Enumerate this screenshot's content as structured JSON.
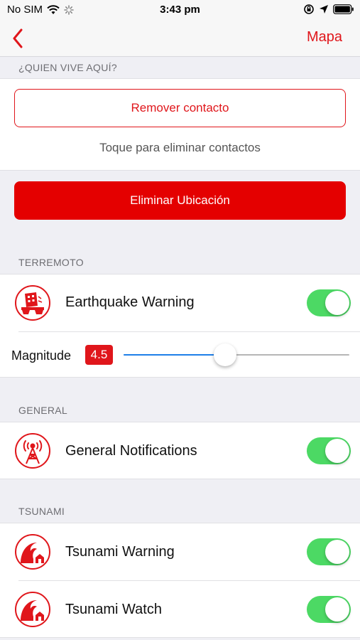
{
  "status_bar": {
    "carrier": "No SIM",
    "time": "3:43 pm",
    "icons": [
      "wifi-icon",
      "activity-spinner-icon",
      "orientation-lock-icon",
      "location-arrow-icon",
      "battery-icon"
    ]
  },
  "nav": {
    "back_icon": "chevron-left-icon",
    "right_label": "Mapa"
  },
  "contacts_section": {
    "header": "¿QUIEN VIVE AQUÍ?",
    "remove_button": "Remover contacto",
    "hint": "Toque para eliminar contactos"
  },
  "delete_location_button": "Eliminar Ubicación",
  "earthquake_section": {
    "header": "TERREMOTO",
    "warning": {
      "label": "Earthquake Warning",
      "icon": "earthquake-building-icon",
      "enabled": true
    },
    "magnitude": {
      "label": "Magnitude",
      "value": "4.5",
      "fraction": 0.45
    }
  },
  "general_section": {
    "header": "GENERAL",
    "notifications": {
      "label": "General Notifications",
      "icon": "antenna-tower-icon",
      "enabled": true
    }
  },
  "tsunami_section": {
    "header": "TSUNAMI",
    "warning": {
      "label": "Tsunami Warning",
      "icon": "tsunami-wave-icon",
      "enabled": true
    },
    "watch": {
      "label": "Tsunami Watch",
      "icon": "tsunami-wave-icon",
      "enabled": true
    }
  },
  "colors": {
    "accent": "#e0161b",
    "toggle_on": "#4cd964",
    "slider_fill": "#1e7fe8"
  }
}
